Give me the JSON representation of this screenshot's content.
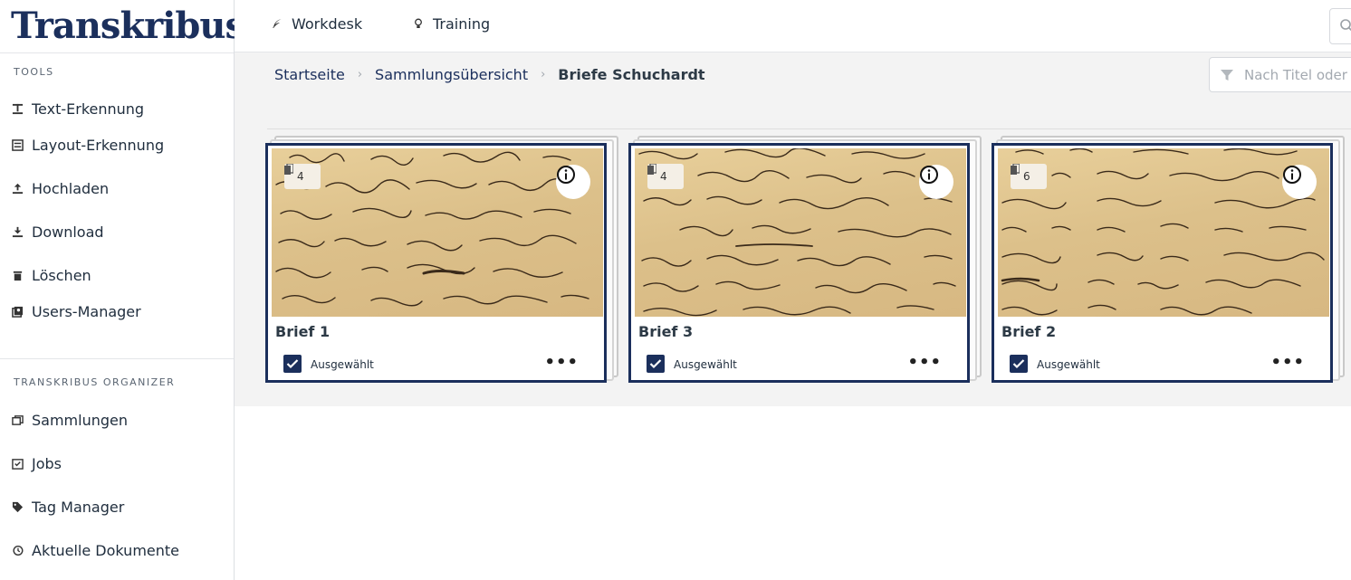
{
  "app": {
    "logo": "Transkribus",
    "logo_mark": "®"
  },
  "sidebar": {
    "tools_heading": "TOOLS",
    "tools": [
      {
        "label": "Text-Erkennung",
        "icon": "text-recognition-icon"
      },
      {
        "label": "Layout-Erkennung",
        "icon": "layout-recognition-icon"
      },
      {
        "label": "Hochladen",
        "icon": "upload-icon"
      },
      {
        "label": "Download",
        "icon": "download-icon"
      },
      {
        "label": "Löschen",
        "icon": "trash-icon"
      },
      {
        "label": "Users-Manager",
        "icon": "users-icon"
      }
    ],
    "organizer_heading": "TRANSKRIBUS ORGANIZER",
    "organizer": [
      {
        "label": "Sammlungen",
        "icon": "collections-icon"
      },
      {
        "label": "Jobs",
        "icon": "jobs-icon"
      },
      {
        "label": "Tag Manager",
        "icon": "tag-icon"
      },
      {
        "label": "Aktuelle Dokumente",
        "icon": "history-icon"
      }
    ]
  },
  "topbar": {
    "workdesk": "Workdesk",
    "training": "Training"
  },
  "breadcrumb": {
    "home": "Startseite",
    "collections": "Sammlungsübersicht",
    "current": "Briefe Schuchardt",
    "separator": "›"
  },
  "filter": {
    "placeholder": "Nach Titel oder I"
  },
  "documents": [
    {
      "title": "Brief 1",
      "pages": "4",
      "selected_label": "Ausgewählt"
    },
    {
      "title": "Brief 3",
      "pages": "4",
      "selected_label": "Ausgewählt"
    },
    {
      "title": "Brief 2",
      "pages": "6",
      "selected_label": "Ausgewählt"
    }
  ],
  "colors": {
    "brand": "#1b2f5c",
    "paper": "#dcc08a",
    "ink": "#3a2a1a"
  }
}
